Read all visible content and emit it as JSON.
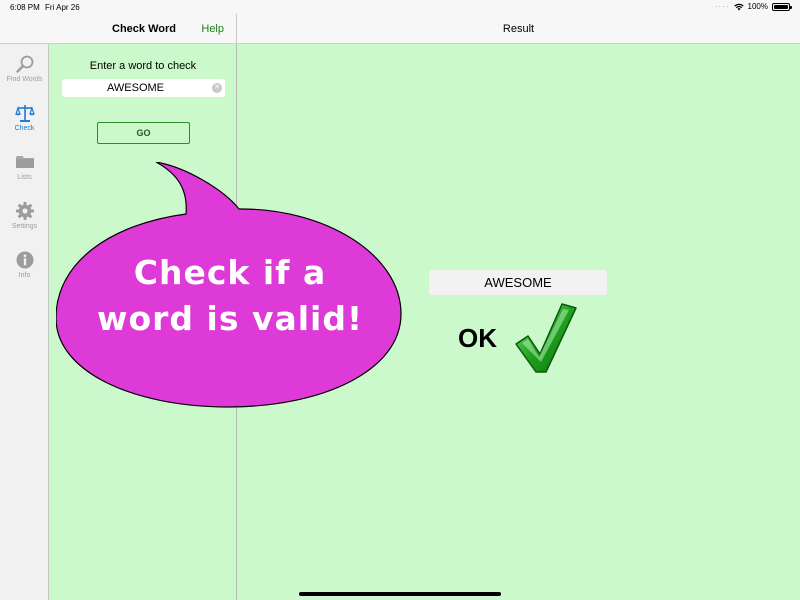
{
  "status": {
    "time": "6:08 PM",
    "date": "Fri Apr 26",
    "battery": "100%"
  },
  "nav": {
    "left_title": "Check Word",
    "help": "Help",
    "right_title": "Result"
  },
  "sidebar": {
    "items": [
      {
        "label": "Find Words",
        "icon": "magnifier-icon",
        "active": false
      },
      {
        "label": "Check",
        "icon": "scales-icon",
        "active": true
      },
      {
        "label": "Lists",
        "icon": "folder-icon",
        "active": false
      },
      {
        "label": "Settings",
        "icon": "gear-icon",
        "active": false
      },
      {
        "label": "Info",
        "icon": "info-icon",
        "active": false
      }
    ]
  },
  "check": {
    "prompt": "Enter a word to check",
    "value": "AWESOME",
    "go": "GO"
  },
  "bubble": {
    "line1": "Check if a",
    "line2": "word is valid!"
  },
  "result": {
    "word": "AWESOME",
    "status": "OK"
  },
  "colors": {
    "background": "#ccf9cc",
    "bubble": "#dd3ad8",
    "accent": "#1a7f1a",
    "active_tab": "#1e7ad6",
    "check": "#1fa41f"
  }
}
